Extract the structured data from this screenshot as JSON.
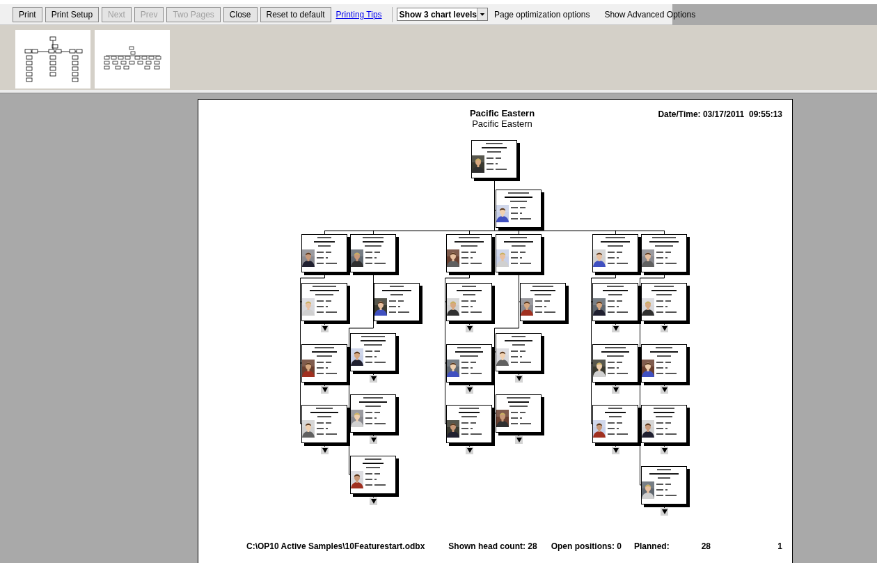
{
  "toolbar": {
    "buttons": [
      {
        "label": "Print",
        "disabled": false
      },
      {
        "label": "Print Setup",
        "disabled": false
      },
      {
        "label": "Next",
        "disabled": true
      },
      {
        "label": "Prev",
        "disabled": true
      },
      {
        "label": "Two Pages",
        "disabled": true
      },
      {
        "label": "Close",
        "disabled": false
      },
      {
        "label": "Reset to default",
        "disabled": false
      }
    ],
    "link": "Printing Tips",
    "levels_select": {
      "value": "Show 3 chart levels"
    },
    "optimization_menu": "Page optimization options",
    "advanced_options": "Show Advanced Options"
  },
  "page": {
    "title": "Pacific Eastern",
    "subtitle": "Pacific Eastern",
    "date_time": "Date/Time: 03/17/2011  09:55:13",
    "chart": {
      "expandable": false,
      "children": [
        {
          "expandable": false
        },
        {
          "expandable": false,
          "children": [
            {
              "expandable": true
            },
            {
              "expandable": true
            },
            {
              "expandable": true
            }
          ]
        },
        {
          "expandable": false,
          "children": [
            {
              "expandable": false
            },
            {
              "expandable": true
            },
            {
              "expandable": true
            },
            {
              "expandable": true
            }
          ]
        },
        {
          "expandable": false,
          "children": [
            {
              "expandable": true
            },
            {
              "expandable": true
            },
            {
              "expandable": true
            }
          ]
        },
        {
          "expandable": false,
          "children": [
            {
              "expandable": false
            },
            {
              "expandable": true
            },
            {
              "expandable": true
            }
          ]
        },
        {
          "expandable": false,
          "children": [
            {
              "expandable": true
            },
            {
              "expandable": true
            },
            {
              "expandable": true
            }
          ]
        },
        {
          "expandable": false,
          "children": [
            {
              "expandable": true
            },
            {
              "expandable": true
            },
            {
              "expandable": true
            },
            {
              "expandable": true
            }
          ]
        }
      ]
    },
    "footer": {
      "file": "C:\\OP10 Active Samples\\10Featurestart.odbx",
      "head_count": "Shown head count: 28",
      "open_positions": "Open positions: 0",
      "planned_label": "Planned:",
      "planned_value": "28",
      "page_number": "1"
    }
  }
}
